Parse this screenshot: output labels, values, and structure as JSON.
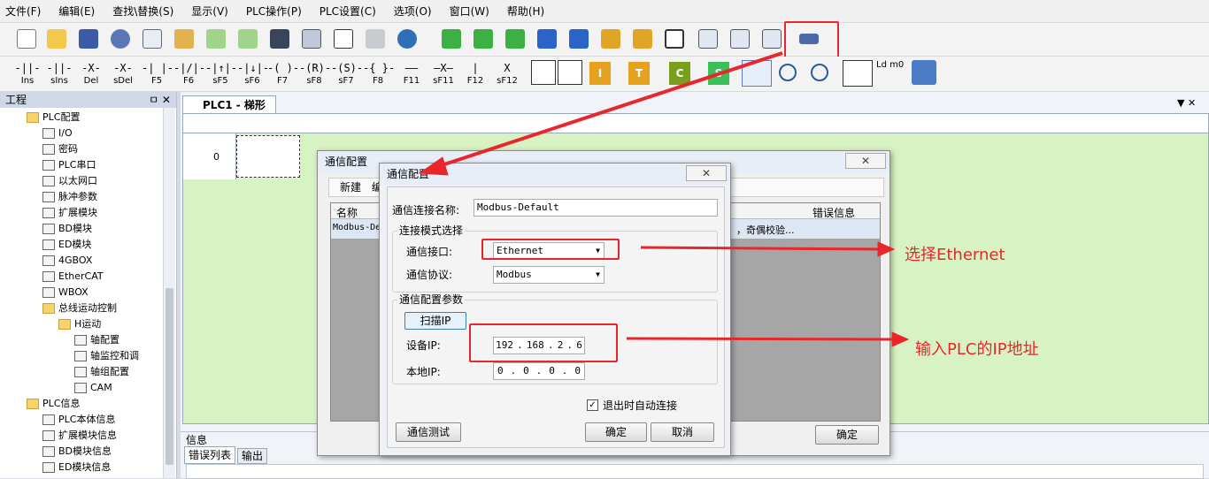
{
  "menu": [
    "文件(F)",
    "编辑(E)",
    "查找\\替换(S)",
    "显示(V)",
    "PLC操作(P)",
    "PLC设置(C)",
    "选项(O)",
    "窗口(W)",
    "帮助(H)"
  ],
  "ladder_tools": [
    {
      "glyph": "-||-",
      "label": "Ins"
    },
    {
      "glyph": "-||-",
      "label": "sIns"
    },
    {
      "glyph": "-X-",
      "label": "Del"
    },
    {
      "glyph": "-X-",
      "label": "sDel"
    },
    {
      "glyph": "-| |-",
      "label": "F5"
    },
    {
      "glyph": "-|/|-",
      "label": "F6"
    },
    {
      "glyph": "-|↑|-",
      "label": "sF5"
    },
    {
      "glyph": "-|↓|-",
      "label": "sF6"
    },
    {
      "glyph": "-( )-",
      "label": "F7"
    },
    {
      "glyph": "-(R)-",
      "label": "sF8"
    },
    {
      "glyph": "-(S)-",
      "label": "sF7"
    },
    {
      "glyph": "-{ }-",
      "label": "F8"
    },
    {
      "glyph": "——",
      "label": "F11"
    },
    {
      "glyph": "—X—",
      "label": "sF11"
    },
    {
      "glyph": " | ",
      "label": "F12"
    },
    {
      "glyph": " X ",
      "label": "sF12"
    }
  ],
  "project_panel": {
    "title": "工程",
    "items": [
      "PLC配置",
      "I/O",
      "密码",
      "PLC串口",
      "以太网口",
      "脉冲参数",
      "扩展模块",
      "BD模块",
      "ED模块",
      "4GBOX",
      "EtherCAT",
      "WBOX",
      "总线运动控制",
      "H运动",
      "轴配置",
      "轴监控和调",
      "轴组配置",
      "CAM",
      "PLC信息",
      "PLC本体信息",
      "扩展模块信息",
      "BD模块信息",
      "ED模块信息"
    ]
  },
  "doc_tab": "PLC1 - 梯形图",
  "ladder_row": "0",
  "info_panel": {
    "title": "信息",
    "tabs": [
      "错误列表",
      "输出"
    ]
  },
  "outer_dialog": {
    "title": "通信配置",
    "toolbar": [
      "新建",
      "编"
    ],
    "col_name": "名称",
    "col_error": "错误信息",
    "row_name": "Modbus-De",
    "row_detail": "，奇偶校验...",
    "ok": "确定"
  },
  "inner_dialog": {
    "title": "通信配置",
    "conn_name_label": "通信连接名称:",
    "conn_name_value": "Modbus-Default",
    "mode_group": "连接模式选择",
    "port_label": "通信接口:",
    "port_value": "Ethernet",
    "protocol_label": "通信协议:",
    "protocol_value": "Modbus",
    "params_group": "通信配置参数",
    "scan_ip": "扫描IP",
    "device_ip_label": "设备IP:",
    "device_ip": [
      "192",
      "168",
      "2",
      "6"
    ],
    "local_ip_label": "本地IP:",
    "local_ip": [
      "0",
      "0",
      "0",
      "0"
    ],
    "auto_connect": "退出时自动连接",
    "test": "通信测试",
    "ok": "确定",
    "cancel": "取消"
  },
  "annotations": {
    "select": "选择Ethernet",
    "input": "输入PLC的IP地址"
  },
  "colors": {
    "annotation": "#e8262b",
    "ladder_bg": "#d8f3c3"
  }
}
